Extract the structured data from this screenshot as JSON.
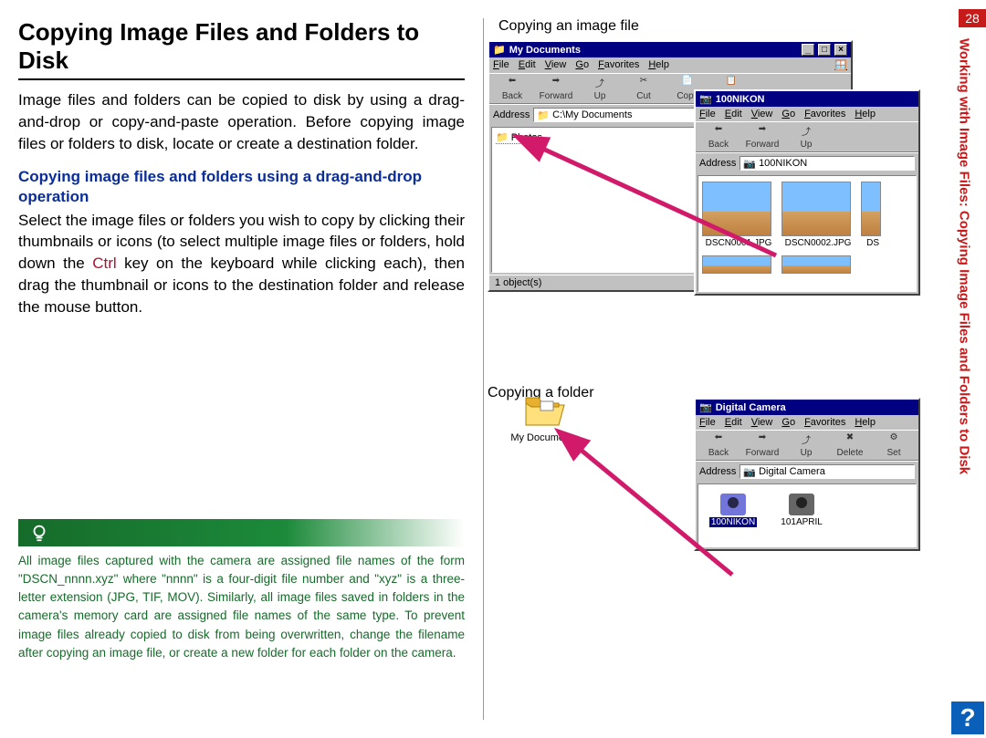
{
  "page_number": "28",
  "side_text": "Working with Image Files: Copying Image Files and Folders to Disk",
  "left": {
    "title": "Copying Image Files and Folders to Disk",
    "intro": "Image files and folders can be copied to disk by using a drag-and-drop or copy-and-paste operation.  Before copying image files or folders to disk, locate or create a destination folder.",
    "subhead": "Copying image files and folders using a drag-and-drop operation",
    "body_a": "Select the image files or folders you wish to copy by clicking their thumbnails or icons (to select multiple image files or folders, hold down the ",
    "ctrl": "Ctrl",
    "body_b": " key on the keyboard while clicking each), then drag the thumbnail or icons to the destination folder and release the mouse button.",
    "tip": "All image files captured with the camera are assigned file names of the form \"DSCN_nnnn.xyz\" where \"nnnn\" is a four-digit file number and \"xyz\" is a three-letter extension (JPG, TIF, MOV).  Similarly, all image files saved in folders in the camera's memory card are assigned file names of the same type.  To prevent image files already copied to disk from being overwritten, change the filename after copying an image file, or create a new folder for each folder on the camera."
  },
  "right": {
    "caption1": "Copying an image file",
    "caption2": "Copying a folder",
    "mydocs_label": "My Documents"
  },
  "win_mydocs": {
    "title": "My Documents",
    "menu": [
      "File",
      "Edit",
      "View",
      "Go",
      "Favorites",
      "Help"
    ],
    "tools": [
      "Back",
      "Forward",
      "Up",
      "Cut",
      "Copy",
      "Paste"
    ],
    "address_label": "Address",
    "address_value": "C:\\My Documents",
    "folder_item": "Photos",
    "status": "1 object(s)"
  },
  "win_nikon": {
    "title": "100NIKON",
    "menu": [
      "File",
      "Edit",
      "View",
      "Go",
      "Favorites",
      "Help"
    ],
    "tools": [
      "Back",
      "Forward",
      "Up"
    ],
    "address_label": "Address",
    "address_value": "100NIKON",
    "thumbs": [
      "DSCN0001.JPG",
      "DSCN0002.JPG",
      "DS"
    ]
  },
  "win_dc": {
    "title": "Digital Camera",
    "menu": [
      "File",
      "Edit",
      "View",
      "Go",
      "Favorites",
      "Help"
    ],
    "tools": [
      "Back",
      "Forward",
      "Up",
      "Delete",
      "Set"
    ],
    "address_label": "Address",
    "address_value": "Digital Camera",
    "items": [
      {
        "label": "100NIKON",
        "selected": true
      },
      {
        "label": "101APRIL",
        "selected": false
      }
    ]
  }
}
